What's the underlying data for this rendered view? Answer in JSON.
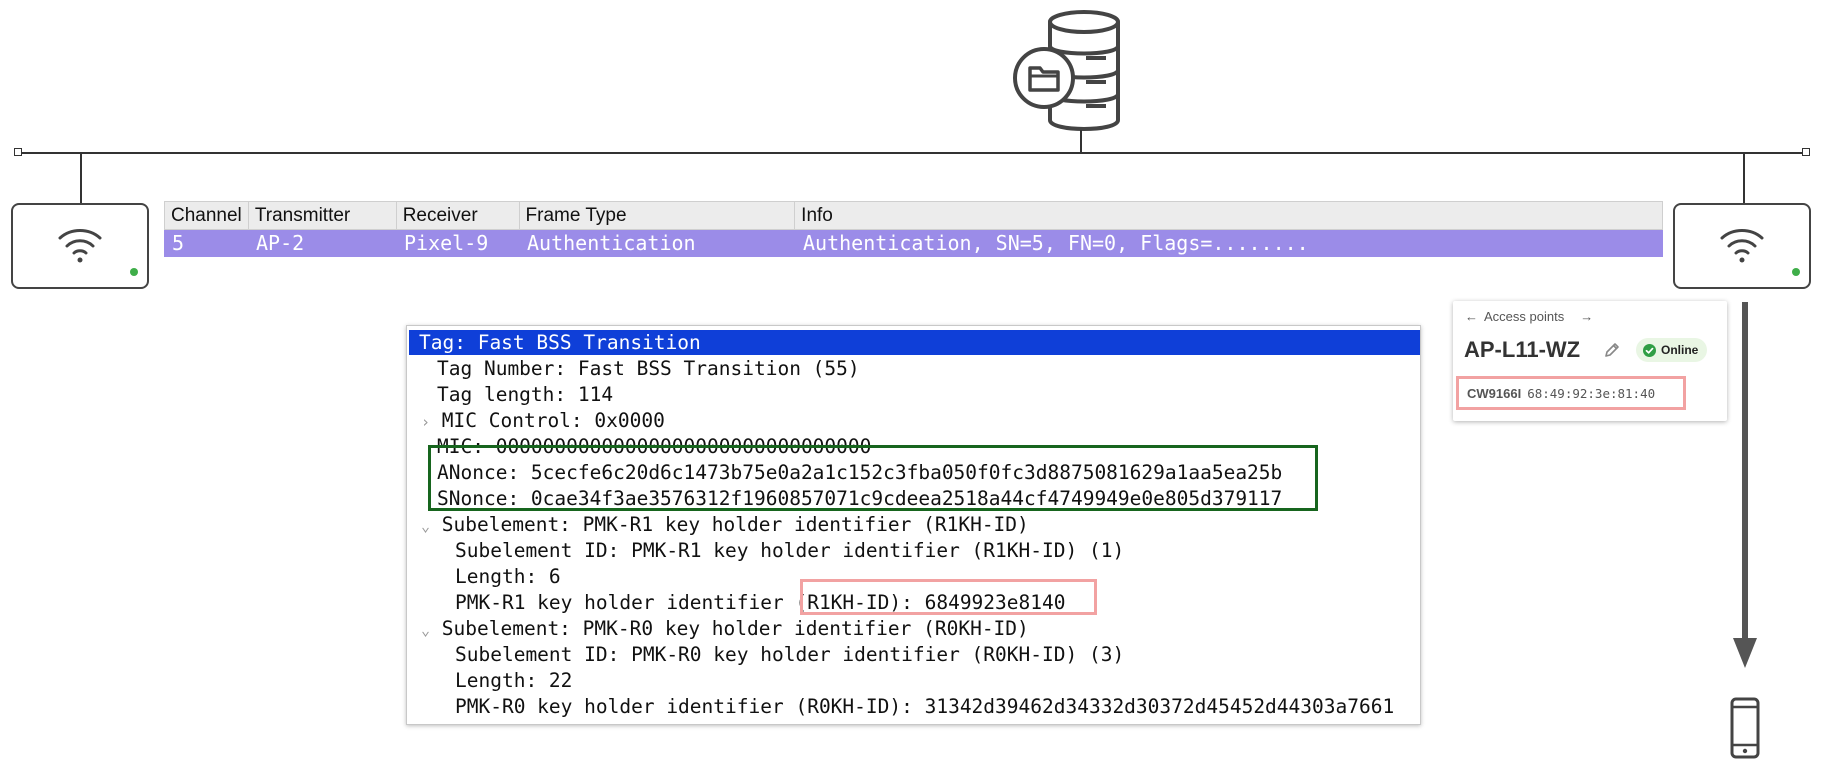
{
  "icons": {
    "server": "database-folder-icon",
    "access_point": "wifi-icon",
    "client": "smartphone-icon",
    "edit": "pencil-icon",
    "online": "check-circle-icon"
  },
  "colors": {
    "selected_packet": "#9b8ce8",
    "selected_tree": "#0f3fd8",
    "nonce_highlight": "#17651e",
    "id_highlight": "#f2a2a2",
    "ap_status_led": "#3fae49"
  },
  "packet_list": {
    "columns": [
      "Channel",
      "Transmitter",
      "Receiver",
      "Frame Type",
      "Info"
    ],
    "rows": [
      {
        "channel": "5",
        "transmitter": "AP-2",
        "receiver": "Pixel-9",
        "frame_type": "Authentication",
        "info": "Authentication, SN=5, FN=0, Flags=........"
      }
    ]
  },
  "packet_details": {
    "selected": "Tag: Fast BSS Transition",
    "lines": [
      "Tag Number: Fast BSS Transition (55)",
      "Tag length: 114",
      "MIC Control: 0x0000",
      "MIC: 00000000000000000000000000000000",
      "ANonce: 5cecfe6c20d6c1473b75e0a2a1c152c3fba050f0fc3d8875081629a1aa5ea25b",
      "SNonce: 0cae34f3ae3576312f1960857071c9cdeea2518a44cf4749949e0e805d379117",
      "Subelement: PMK-R1 key holder identifier (R1KH-ID)",
      "Subelement ID: PMK-R1 key holder identifier (R1KH-ID) (1)",
      "Length: 6",
      "PMK-R1 key holder identifier (R1KH-ID): 6849923e8140",
      "Subelement: PMK-R0 key holder identifier (R0KH-ID)",
      "Subelement ID: PMK-R0 key holder identifier (R0KH-ID) (3)",
      "Length: 22",
      "PMK-R0 key holder identifier (R0KH-ID): 31342d39462d34332d30372d45452d44303a7661"
    ]
  },
  "ap_card": {
    "back_label": "Access points",
    "forward_glyph": "→",
    "back_glyph": "←",
    "name": "AP-L11-WZ",
    "status": "Online",
    "model": "CW9166I",
    "mac": "68:49:92:3e:81:40"
  }
}
